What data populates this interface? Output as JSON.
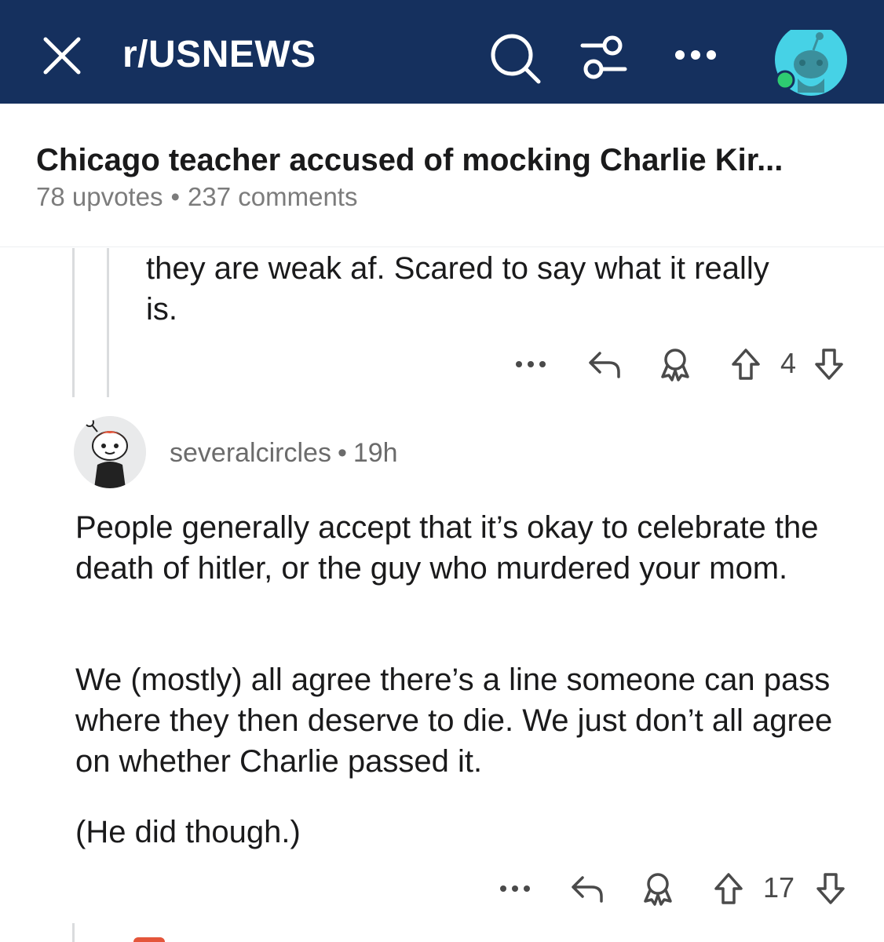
{
  "header": {
    "subreddit": "r/USNEWS",
    "icons": [
      "close-icon",
      "search-icon",
      "filter-icon",
      "more-icon",
      "avatar"
    ],
    "bg_color": "#15305e"
  },
  "post": {
    "title": "Chicago teacher accused of mocking Charlie Kir...",
    "upvotes": "78 upvotes",
    "separator": "•",
    "comments": "237 comments"
  },
  "comments": [
    {
      "text_lines": [
        "they are weak af. Scared to say what it really",
        "is."
      ],
      "vote_count": "4"
    },
    {
      "author": "severalcircles",
      "separator": "•",
      "age": "19h",
      "paragraphs": [
        "People generally accept that it’s okay to celebrate the death of hitler, or the guy who murdered your mom.",
        "We (mostly) all agree there’s a line someone can pass where they then deserve to die. We just don’t all agree on whether Charlie passed it.",
        "(He did though.)"
      ],
      "vote_count": "17"
    }
  ],
  "colors": {
    "online_dot": "#2ecc71",
    "avatar_bg": "#46d2e6",
    "thread_line": "#dadcde"
  }
}
